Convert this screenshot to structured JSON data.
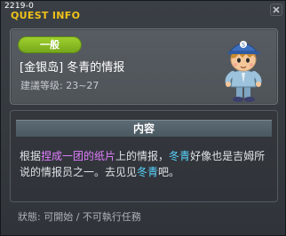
{
  "window": {
    "quest_id": "2219-0",
    "title": "QUEST INFO"
  },
  "quest": {
    "category": "一般",
    "name": "[金银岛] 冬青的情报",
    "level_range": "建議等级: 23~27",
    "npc_icon": "npc-boy-blue-cap-icon"
  },
  "content": {
    "header": "内容",
    "text_parts": {
      "p1": "根据",
      "p2": "捏成一团的纸片",
      "p3": "上的情报，",
      "p4": "冬青",
      "p5": "好像也是吉姆所说的情报员之一。去见见",
      "p6": "冬青",
      "p7": "吧。"
    }
  },
  "status": {
    "text": "狀態: 可開始 / 不可執行任務"
  },
  "colors": {
    "title": "#f0c21a",
    "badge": "#8cc224",
    "highlight_item": "#e27dff",
    "highlight_npc": "#59d4ff"
  }
}
